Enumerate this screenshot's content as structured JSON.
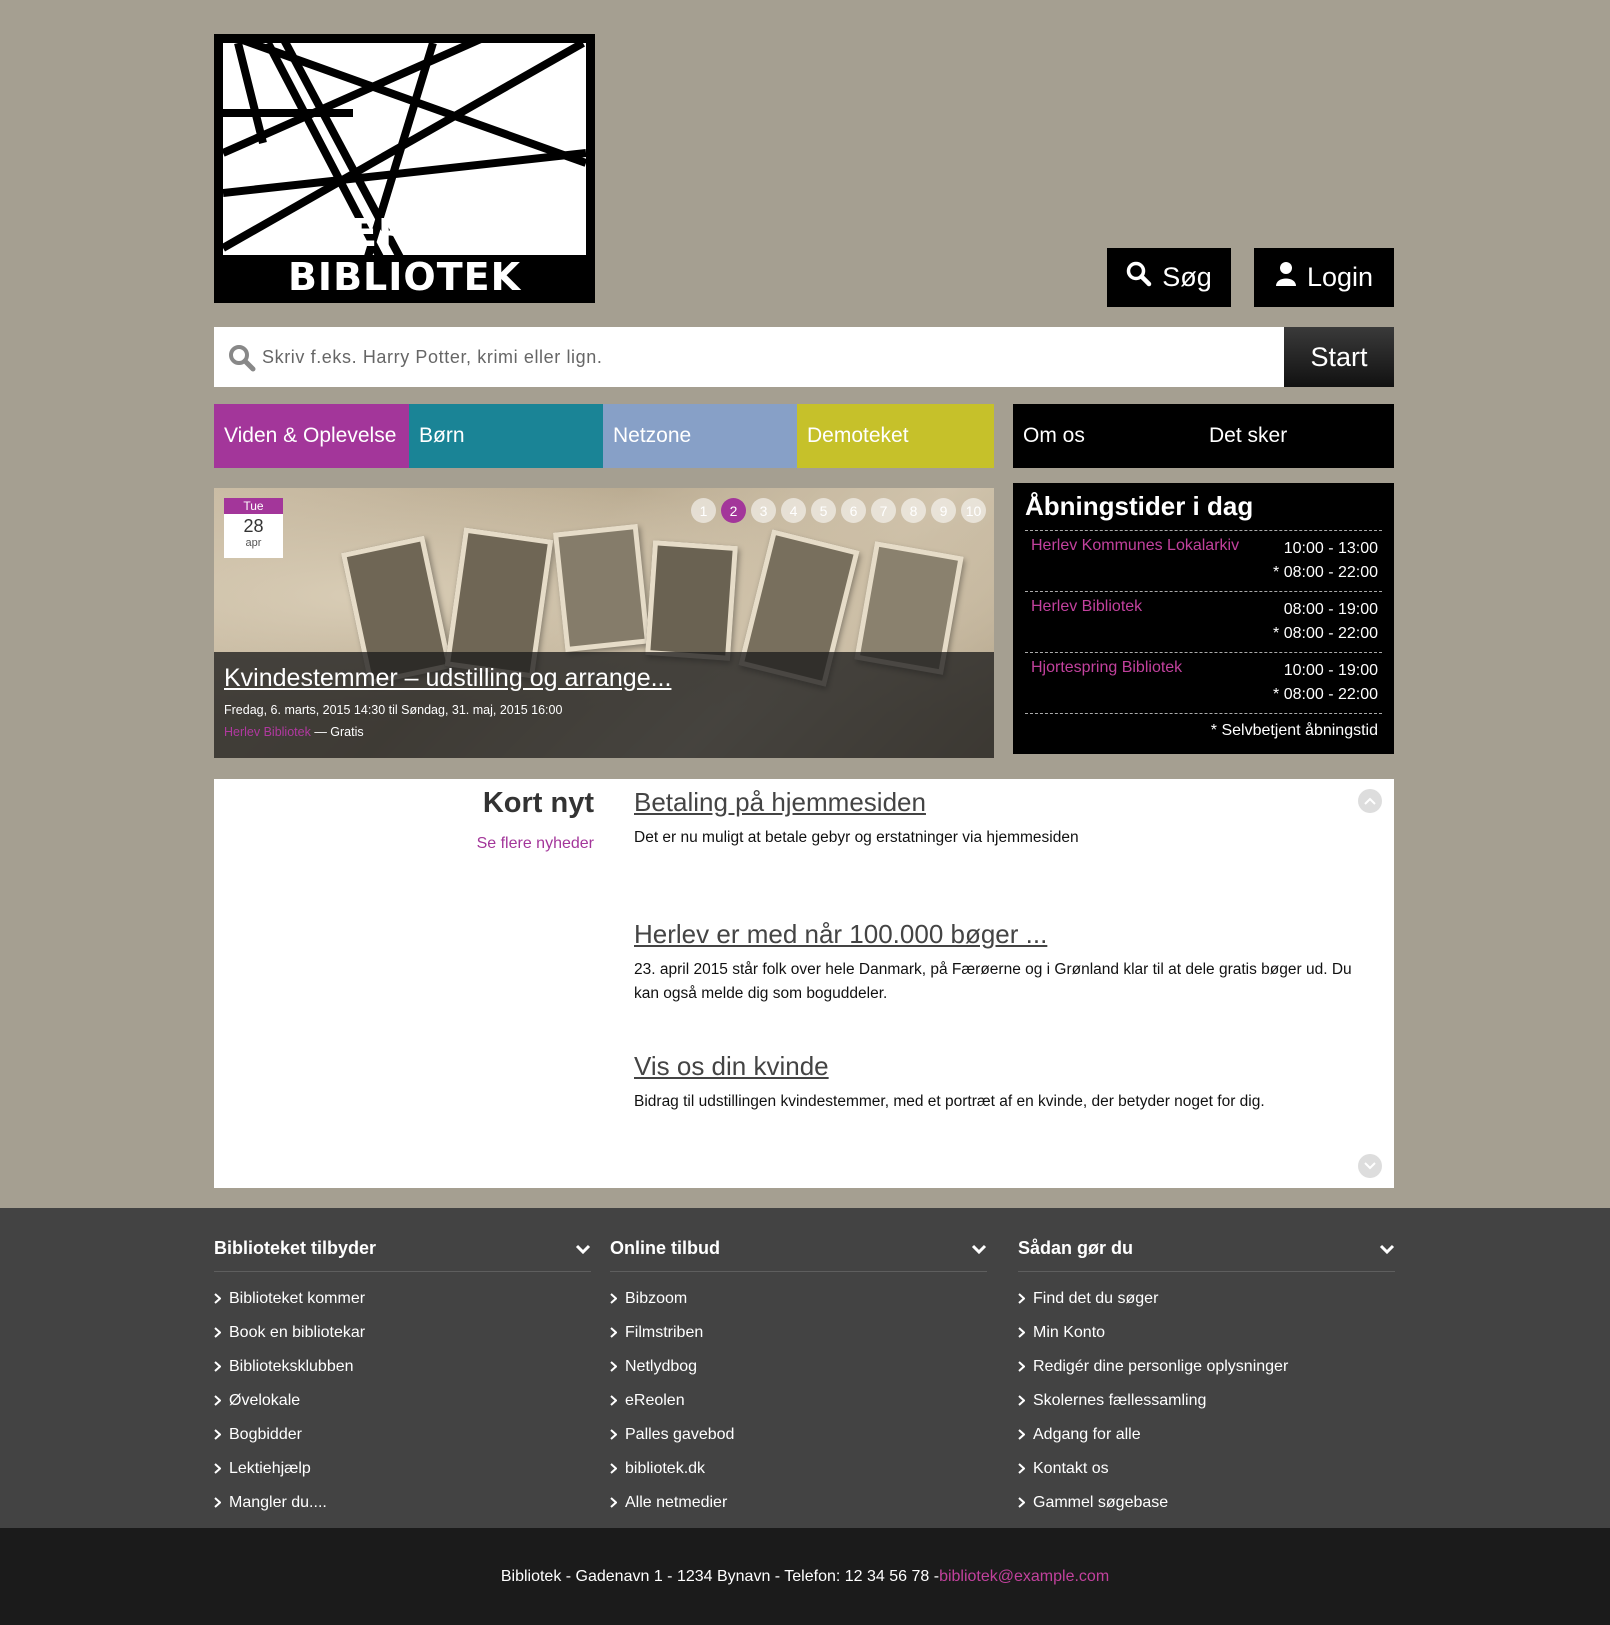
{
  "brand": {
    "name": "HERLEV BIBLIOTEK"
  },
  "header": {
    "search_label": "Søg",
    "login_label": "Login"
  },
  "search": {
    "placeholder": "Skriv f.eks. Harry Potter, krimi eller lign.",
    "button_label": "Start"
  },
  "nav": {
    "items": [
      {
        "label": "Viden & Oplevelse",
        "color": "#a3369a"
      },
      {
        "label": "Børn",
        "color": "#1a8496"
      },
      {
        "label": "Netzone",
        "color": "#87a0c7"
      },
      {
        "label": "Demoteket",
        "color": "#c6c12a"
      }
    ],
    "secondary": [
      "Om os",
      "Det sker"
    ]
  },
  "slider": {
    "date": {
      "weekday": "Tue",
      "day": "28",
      "month": "apr"
    },
    "pages": [
      "1",
      "2",
      "3",
      "4",
      "5",
      "6",
      "7",
      "8",
      "9",
      "10"
    ],
    "active_page": 2,
    "event_title": "Kvindestemmer – udstilling og arrange...",
    "event_dates": "Fredag, 6. marts, 2015 14:30 til Søndag, 31. maj, 2015 16:00",
    "event_place": "Herlev Bibliotek",
    "event_separator": " — ",
    "event_price": "Gratis"
  },
  "hours": {
    "title": "Åbningstider i dag",
    "rows": [
      {
        "library": "Herlev Kommunes Lokalarkiv",
        "open": "10:00 - 13:00",
        "self": "* 08:00 - 22:00"
      },
      {
        "library": "Herlev Bibliotek",
        "open": "08:00 - 19:00",
        "self": "* 08:00 - 22:00"
      },
      {
        "library": "Hjortespring Bibliotek",
        "open": "10:00 - 19:00",
        "self": "* 08:00 - 22:00"
      }
    ],
    "note": "* Selvbetjent åbningstid"
  },
  "news": {
    "title": "Kort nyt",
    "more_link": "Se flere nyheder",
    "items": [
      {
        "heading": "Betaling på hjemmesiden",
        "text": "Det er nu muligt at betale gebyr og erstatninger via hjemmesiden"
      },
      {
        "heading": "Herlev er med når 100.000 bøger ...",
        "text": "23. april 2015 står folk over hele Danmark, på Færøerne og i Grønland klar til at dele gratis bøger ud. Du kan også melde dig som boguddeler."
      },
      {
        "heading": "Vis os din kvinde",
        "text": "Bidrag til udstillingen kvindestemmer, med et portræt af en kvinde, der betyder noget for dig."
      }
    ]
  },
  "footer": {
    "columns": [
      {
        "title": "Biblioteket tilbyder",
        "links": [
          "Biblioteket kommer",
          "Book en bibliotekar",
          "Biblioteksklubben",
          "Øvelokale",
          "Bogbidder",
          "Lektiehjælp",
          "Mangler du...."
        ]
      },
      {
        "title": "Online tilbud",
        "links": [
          "Bibzoom",
          "Filmstriben",
          "Netlydbog",
          "eReolen",
          "Palles gavebod",
          "bibliotek.dk",
          "Alle netmedier"
        ]
      },
      {
        "title": "Sådan gør du",
        "links": [
          "Find det du søger",
          "Min Konto",
          "Redigér dine personlige oplysninger",
          "Skolernes fællessamling",
          "Adgang for alle",
          "Kontakt os",
          "Gammel søgebase"
        ]
      }
    ],
    "address": "Bibliotek - Gadenavn 1 - 1234 Bynavn - Telefon: 12 34 56 78 - ",
    "email": "bibliotek@example.com"
  }
}
